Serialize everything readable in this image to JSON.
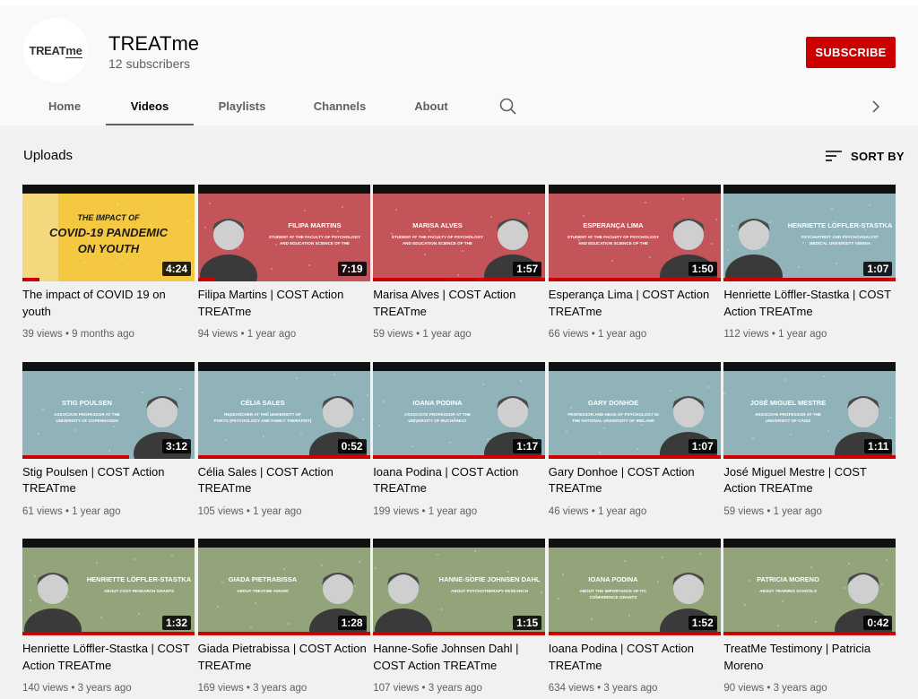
{
  "channel": {
    "logo_text_a": "TREAT",
    "logo_text_b": "me",
    "name": "TREATme",
    "subscribers": "12 subscribers",
    "subscribe_label": "SUBSCRIBE"
  },
  "tabs": [
    "Home",
    "Videos",
    "Playlists",
    "Channels",
    "About"
  ],
  "active_tab": "Videos",
  "section": {
    "title": "Uploads",
    "sort_label": "SORT BY"
  },
  "colors": {
    "accent": "#cc0000",
    "thumb_yellow": "#f5c842",
    "thumb_red": "#c3555a",
    "thumb_teal": "#8fb3b8",
    "thumb_green": "#93a37a"
  },
  "videos": [
    {
      "title": "The impact of COVID 19 on youth",
      "views": "39 views",
      "age": "9 months ago",
      "duration": "4:24",
      "theme": "yellow",
      "overlay_1": "THE IMPACT OF",
      "overlay_2": "COVID-19 PANDEMIC",
      "overlay_3": "ON YOUTH",
      "watched_fraction": 0.1
    },
    {
      "title": "Filipa Martins | COST Action TREATme",
      "views": "94 views",
      "age": "1 year ago",
      "duration": "7:19",
      "theme": "red",
      "overlay_1": "FILIPA MARTINS",
      "overlay_2": "STUDENT AT THE FACULTY OF PSYCHOLOGY",
      "overlay_3": "AND EDUCATION SCIENCE OF THE",
      "watched_fraction": 0.1
    },
    {
      "title": "Marisa Alves | COST Action TREATme",
      "views": "59 views",
      "age": "1 year ago",
      "duration": "1:57",
      "theme": "red",
      "overlay_1": "MARISA ALVES",
      "overlay_2": "STUDENT AT THE FACULTY OF PSYCHOLOGY",
      "overlay_3": "AND EDUCATION SCIENCE OF THE",
      "watched_fraction": 1
    },
    {
      "title": "Esperança Lima | COST Action TREATme",
      "views": "66 views",
      "age": "1 year ago",
      "duration": "1:50",
      "theme": "red",
      "overlay_1": "ESPERANÇA LIMA",
      "overlay_2": "STUDENT AT THE FACULTY OF PSYCHOLOGY",
      "overlay_3": "AND EDUCATION SCIENCE OF THE",
      "watched_fraction": 1
    },
    {
      "title": "Henriette Löffler-Stastka | COST Action TREATme",
      "views": "112 views",
      "age": "1 year ago",
      "duration": "1:07",
      "theme": "teal",
      "overlay_1": "HENRIETTE LÖFFLER-STASTKA",
      "overlay_2": "PSYCHIATRIST AND PSYCHOANALYST",
      "overlay_3": "MEDICAL UNIVERSITY VIENNA",
      "watched_fraction": 1
    },
    {
      "title": "Stig Poulsen | COST Action TREATme",
      "views": "61 views",
      "age": "1 year ago",
      "duration": "3:12",
      "theme": "teal",
      "overlay_1": "STIG POULSEN",
      "overlay_2": "ASSOCIATE PROFESSOR AT THE",
      "overlay_3": "UNIVERSITY OF COPENHAGEN",
      "watched_fraction": 0.62
    },
    {
      "title": "Célia Sales | COST Action TREATme",
      "views": "105 views",
      "age": "1 year ago",
      "duration": "0:52",
      "theme": "teal",
      "overlay_1": "CÉLIA SALES",
      "overlay_2": "RESEARCHER AT THE UNIVERSITY OF",
      "overlay_3": "PORTO (PSYCHOLOGY AND FAMILY THERAPIST)",
      "watched_fraction": 1
    },
    {
      "title": "Ioana Podina | COST Action TREATme",
      "views": "199 views",
      "age": "1 year ago",
      "duration": "1:17",
      "theme": "teal",
      "overlay_1": "IOANA PODINA",
      "overlay_2": "ASSOCIATE PROFESSOR AT THE",
      "overlay_3": "UNIVERSITY OF BUCHAREST",
      "watched_fraction": 1
    },
    {
      "title": "Gary Donhoe | COST Action TREATme",
      "views": "46 views",
      "age": "1 year ago",
      "duration": "1:07",
      "theme": "teal",
      "overlay_1": "GARY DONHOE",
      "overlay_2": "PROFESSOR AND HEAD OF PSYCHOLOGY IN",
      "overlay_3": "THE NATIONAL UNIVERSITY OF IRELAND",
      "watched_fraction": 1
    },
    {
      "title": "José Miguel Mestre | COST Action TREATme",
      "views": "59 views",
      "age": "1 year ago",
      "duration": "1:11",
      "theme": "teal",
      "overlay_1": "JOSÉ MIGUEL MESTRE",
      "overlay_2": "ASSOCIATE PROFESSOR AT THE",
      "overlay_3": "UNIVERSITY OF CÁDIZ",
      "watched_fraction": 1
    },
    {
      "title": "Henriette Löffler-Stastka | COST Action TREATme",
      "views": "140 views",
      "age": "3 years ago",
      "duration": "1:32",
      "theme": "green",
      "overlay_1": "HENRIETTE LÖFFLER-STASTKA",
      "overlay_2": "ABOUT COST RESEARCH GRANTS",
      "overlay_3": "",
      "watched_fraction": 1
    },
    {
      "title": "Giada Pietrabissa | COST Action TREATme",
      "views": "169 views",
      "age": "3 years ago",
      "duration": "1:28",
      "theme": "green",
      "overlay_1": "GIADA PIETRABISSA",
      "overlay_2": "ABOUT TREATME AWARD",
      "overlay_3": "",
      "watched_fraction": 1
    },
    {
      "title": "Hanne-Sofie Johnsen Dahl | COST Action TREATme",
      "views": "107 views",
      "age": "3 years ago",
      "duration": "1:15",
      "theme": "green",
      "overlay_1": "HANNE-SOFIE JOHNSEN DAHL",
      "overlay_2": "ABOUT PSYCHOTHERAPY RESEARCH",
      "overlay_3": "",
      "watched_fraction": 1
    },
    {
      "title": "Ioana Podina | COST Action TREATme",
      "views": "634 views",
      "age": "3 years ago",
      "duration": "1:52",
      "theme": "green",
      "overlay_1": "IOANA PODINA",
      "overlay_2": "ABOUT THE IMPORTANCE OF ITC",
      "overlay_3": "CONFERENCE GRANTS",
      "watched_fraction": 1
    },
    {
      "title": "TreatMe Testimony | Patricia Moreno",
      "views": "90 views",
      "age": "3 years ago",
      "duration": "0:42",
      "theme": "green",
      "overlay_1": "PATRICIA MORENO",
      "overlay_2": "ABOUT TRAINING SCHOOLS",
      "overlay_3": "",
      "watched_fraction": 1
    }
  ]
}
